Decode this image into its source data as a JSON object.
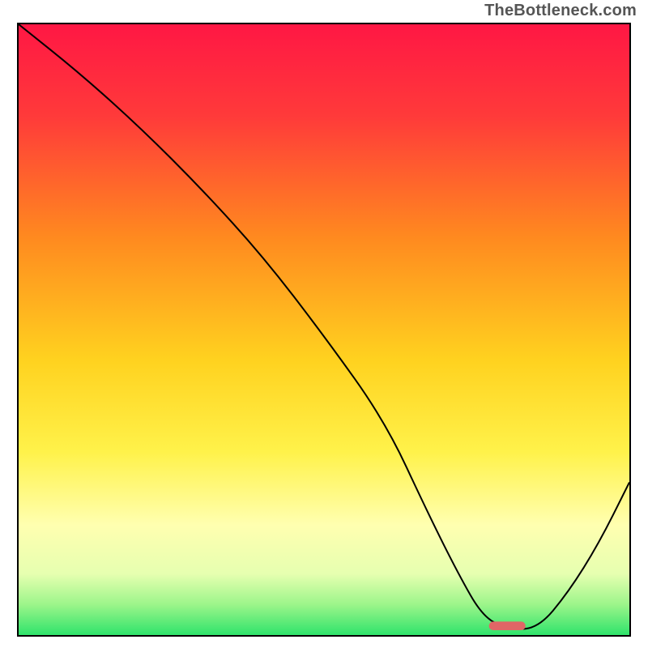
{
  "watermark": "TheBottleneck.com",
  "chart_data": {
    "type": "line",
    "title": "",
    "xlabel": "",
    "ylabel": "",
    "xlim": [
      0,
      100
    ],
    "ylim": [
      0,
      100
    ],
    "grid": false,
    "legend": false,
    "gradient_stops": [
      {
        "pct": 0,
        "color": "#ff1744"
      },
      {
        "pct": 15,
        "color": "#ff3a3a"
      },
      {
        "pct": 35,
        "color": "#ff8a1f"
      },
      {
        "pct": 55,
        "color": "#ffd21f"
      },
      {
        "pct": 70,
        "color": "#fff24a"
      },
      {
        "pct": 82,
        "color": "#ffffb0"
      },
      {
        "pct": 90,
        "color": "#e6ffb0"
      },
      {
        "pct": 95,
        "color": "#9cf58a"
      },
      {
        "pct": 100,
        "color": "#2fe36b"
      }
    ],
    "series": [
      {
        "name": "bottleneck-curve",
        "color": "#000000",
        "x": [
          0,
          10,
          20,
          30,
          40,
          50,
          60,
          67,
          72,
          76,
          80,
          85,
          90,
          95,
          100
        ],
        "y": [
          100,
          92,
          83,
          73,
          62,
          49,
          35,
          20,
          10,
          3,
          1,
          1,
          7,
          15,
          25
        ]
      }
    ],
    "marker": {
      "name": "optimal-range",
      "color": "#e06666",
      "x_start": 77,
      "x_end": 83,
      "y": 1.5,
      "thickness_pct": 1.4
    }
  }
}
